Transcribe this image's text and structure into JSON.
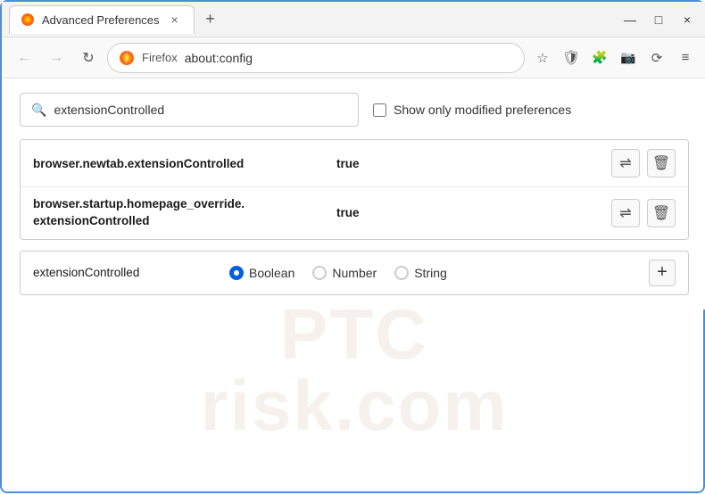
{
  "window": {
    "title": "Advanced Preferences",
    "tab_close": "×",
    "new_tab": "+",
    "min_btn": "—",
    "max_btn": "□",
    "close_btn": "×"
  },
  "nav": {
    "back_label": "←",
    "forward_label": "→",
    "reload_label": "↻",
    "browser_name": "Firefox",
    "url": "about:config",
    "bookmark_icon": "☆",
    "shield_icon": "⛨",
    "extension_icon": "🧩",
    "screenshot_icon": "📷",
    "sync_icon": "⟳",
    "menu_icon": "≡"
  },
  "search": {
    "placeholder": "extensionControlled",
    "value": "extensionControlled",
    "checkbox_label": "Show only modified preferences"
  },
  "preferences": [
    {
      "name": "browser.newtab.extensionControlled",
      "value": "true"
    },
    {
      "name": "browser.startup.homepage_override.\nextensionControlled",
      "name_line1": "browser.startup.homepage_override.",
      "name_line2": "extensionControlled",
      "value": "true",
      "multi_line": true
    }
  ],
  "new_pref": {
    "name": "extensionControlled",
    "types": [
      "Boolean",
      "Number",
      "String"
    ],
    "selected_type": "Boolean",
    "add_label": "+"
  },
  "swap_icon": "⇌",
  "delete_icon": "🗑",
  "watermark": {
    "line1": "PTC",
    "line2": "risk.com"
  }
}
